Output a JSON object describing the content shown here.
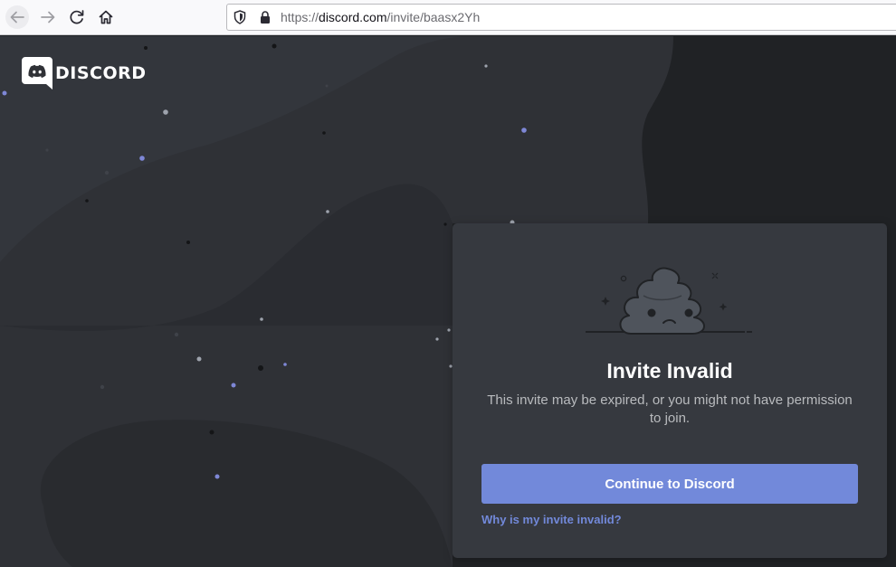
{
  "browser": {
    "url_prefix": "https://",
    "url_domain": "discord.com",
    "url_path": "/invite/baasx2Yh"
  },
  "brand": {
    "wordmark": "DISCORD"
  },
  "card": {
    "title": "Invite Invalid",
    "description": "This invite may be expired, or you might not have permission to join.",
    "continue_label": "Continue to Discord",
    "help_link": "Why is my invite invalid?"
  },
  "icons": {
    "back": "back-arrow-icon",
    "forward": "forward-arrow-icon",
    "reload": "reload-icon",
    "home": "home-icon",
    "tracking": "shield-icon",
    "secure": "lock-icon",
    "logo": "discord-logo-icon",
    "illustration": "poop-illustration"
  },
  "colors": {
    "background": "#202225",
    "card": "#36393f",
    "accent": "#7289da",
    "text_primary": "#ffffff",
    "text_secondary": "#b9bbbe"
  }
}
